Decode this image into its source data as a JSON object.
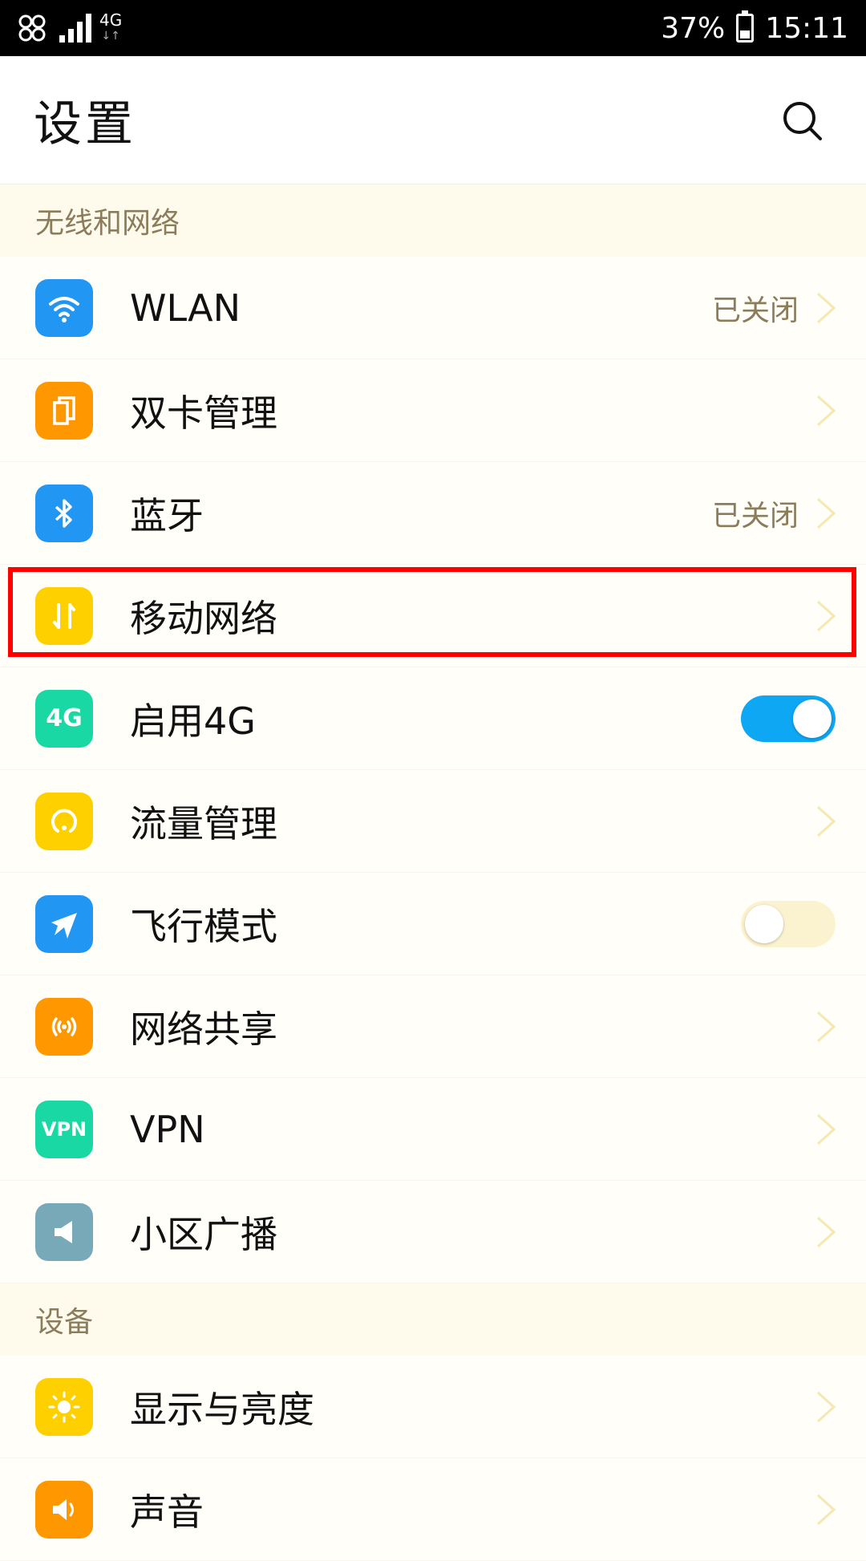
{
  "status_bar": {
    "network": "4G",
    "battery": "37%",
    "time": "15:11",
    "signal_bars": 4
  },
  "header": {
    "title": "设置",
    "search_icon": "search-icon"
  },
  "sections": [
    {
      "title": "无线和网络",
      "items": [
        {
          "label": "WLAN",
          "status": "已关闭",
          "icon": "wifi-icon",
          "color": "#2196f3"
        },
        {
          "label": "双卡管理",
          "icon": "dual-sim-icon",
          "color": "#ff9800"
        },
        {
          "label": "蓝牙",
          "status": "已关闭",
          "icon": "bluetooth-icon",
          "color": "#2196f3"
        },
        {
          "label": "移动网络",
          "icon": "mobile-data-icon",
          "color": "#ffd000"
        },
        {
          "label": "启用4G",
          "icon_text": "4G",
          "icon": "4g-icon",
          "color": "#19d8a4",
          "toggle": "on"
        },
        {
          "label": "流量管理",
          "icon": "data-usage-icon",
          "color": "#ffd000"
        },
        {
          "label": "飞行模式",
          "icon": "airplane-icon",
          "color": "#2196f3",
          "toggle": "off"
        },
        {
          "label": "网络共享",
          "icon": "hotspot-icon",
          "color": "#ff9800"
        },
        {
          "label": "VPN",
          "icon_text": "VPN",
          "icon": "vpn-icon",
          "color": "#19d8a4"
        },
        {
          "label": "小区广播",
          "icon": "broadcast-icon",
          "color": "#78a9b8"
        }
      ]
    },
    {
      "title": "设备",
      "items": [
        {
          "label": "显示与亮度",
          "icon": "brightness-icon",
          "color": "#ffd000"
        },
        {
          "label": "声音",
          "icon": "sound-icon",
          "color": "#ff9800"
        }
      ]
    }
  ],
  "colors": {
    "accent_toggle_on": "#0ea7f3",
    "highlight": "#ff0000",
    "section_text": "#8b7d5c"
  }
}
